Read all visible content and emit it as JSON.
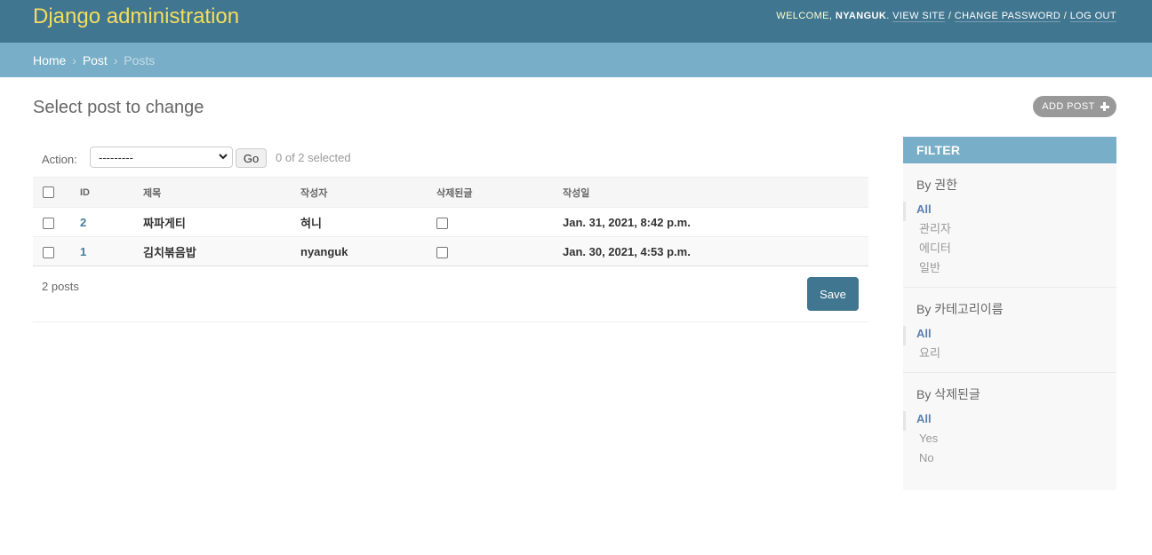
{
  "header": {
    "brand": "Django administration",
    "welcome": "WELCOME,",
    "username": "NYANGUK",
    "view_site": "VIEW SITE",
    "change_password": "CHANGE PASSWORD",
    "log_out": "LOG OUT",
    "sep": "/"
  },
  "breadcrumbs": {
    "home": "Home",
    "app": "Post",
    "current": "Posts",
    "sep": "›"
  },
  "page": {
    "title": "Select post to change",
    "add_button": "ADD POST"
  },
  "actions": {
    "label": "Action:",
    "selected_option": "---------",
    "go": "Go",
    "counter": "0 of 2 selected"
  },
  "table": {
    "headers": [
      "ID",
      "제목",
      "작성자",
      "삭제된글",
      "작성일"
    ],
    "rows": [
      {
        "id": "2",
        "title": "짜파게티",
        "author": "혀니",
        "deleted": false,
        "date": "Jan. 31, 2021, 8:42 p.m."
      },
      {
        "id": "1",
        "title": "김치볶음밥",
        "author": "nyanguk",
        "deleted": false,
        "date": "Jan. 30, 2021, 4:53 p.m."
      }
    ]
  },
  "paginator": {
    "count": "2 posts",
    "save": "Save"
  },
  "filter": {
    "title": "FILTER",
    "groups": [
      {
        "title": "By 권한",
        "options": [
          "All",
          "관리자",
          "에디터",
          "일반"
        ]
      },
      {
        "title": "By 카테고리이름",
        "options": [
          "All",
          "요리"
        ]
      },
      {
        "title": "By 삭제된글",
        "options": [
          "All",
          "Yes",
          "No"
        ]
      }
    ]
  },
  "colors": {
    "header": "#417690",
    "breadcrumbs": "#79aec8",
    "brand": "#f5dd5d",
    "link": "#447e9b"
  }
}
